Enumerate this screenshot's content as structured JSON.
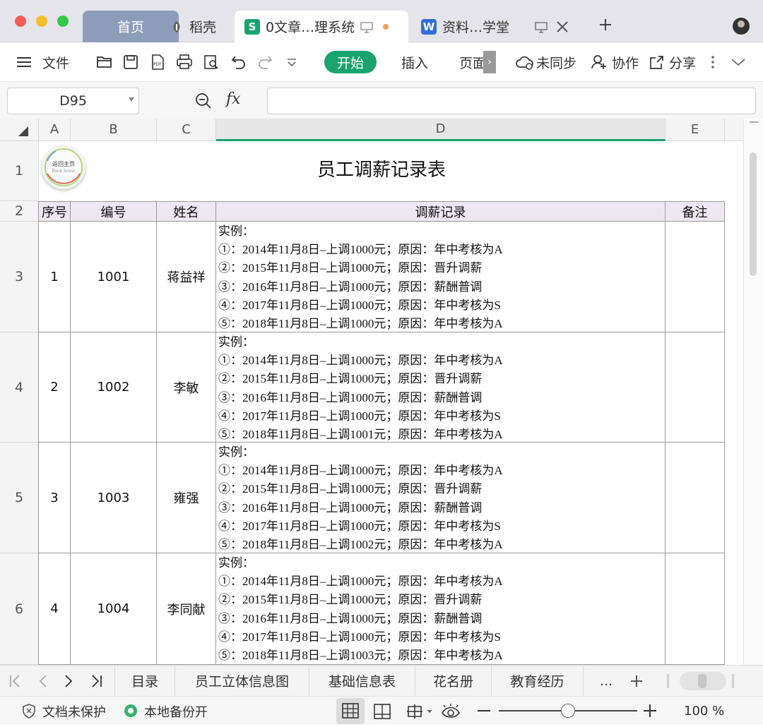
{
  "window": {
    "tabs": [
      {
        "label": "首页"
      },
      {
        "label": "稻壳"
      },
      {
        "label": "0文章…理系统"
      },
      {
        "label": "资料…学堂"
      }
    ]
  },
  "toolbar": {
    "file_label": "文件",
    "ribbon_tabs": [
      "开始",
      "插入",
      "页面"
    ],
    "sync_label": "未同步",
    "collab_label": "协作",
    "share_label": "分享"
  },
  "formula_bar": {
    "cell_ref": "D95",
    "fx_label": "fx",
    "formula_value": ""
  },
  "grid": {
    "columns": [
      "A",
      "B",
      "C",
      "D",
      "E"
    ],
    "rows": [
      "1",
      "2",
      "3",
      "4",
      "5",
      "6"
    ],
    "title": "员工调薪记录表",
    "logo_text": "返回主页",
    "logo_subtext": "Back home",
    "headers": [
      "序号",
      "编号",
      "姓名",
      "调薪记录",
      "备注"
    ],
    "records": [
      {
        "seq": "1",
        "id": "1001",
        "name": "蒋益祥",
        "lines": [
          "实例：",
          "①：2014年11月8日–上调1000元；原因：年中考核为A",
          "②：2015年11月8日–上调1000元；原因：晋升调薪",
          "③：2016年11月8日–上调1000元；原因：薪酬普调",
          "④：2017年11月8日–上调1000元；原因：年中考核为S",
          "⑤：2018年11月8日–上调1000元；原因：年中考核为A"
        ]
      },
      {
        "seq": "2",
        "id": "1002",
        "name": "李敏",
        "lines": [
          "实例：",
          "①：2014年11月8日–上调1000元；原因：年中考核为A",
          "②：2015年11月8日–上调1000元；原因：晋升调薪",
          "③：2016年11月8日–上调1000元；原因：薪酬普调",
          "④：2017年11月8日–上调1000元；原因：年中考核为S",
          "⑤：2018年11月8日–上调1001元；原因：年中考核为A"
        ]
      },
      {
        "seq": "3",
        "id": "1003",
        "name": "雍强",
        "lines": [
          "实例：",
          "①：2014年11月8日–上调1000元；原因：年中考核为A",
          "②：2015年11月8日–上调1000元；原因：晋升调薪",
          "③：2016年11月8日–上调1000元；原因：薪酬普调",
          "④：2017年11月8日–上调1000元；原因：年中考核为S",
          "⑤：2018年11月8日–上调1002元；原因：年中考核为A"
        ]
      },
      {
        "seq": "4",
        "id": "1004",
        "name": "李同献",
        "lines": [
          "实例：",
          "①：2014年11月8日–上调1000元；原因：年中考核为A",
          "②：2015年11月8日–上调1000元；原因：晋升调薪",
          "③：2016年11月8日–上调1000元；原因：薪酬普调",
          "④：2017年11月8日–上调1000元；原因：年中考核为S",
          "⑤：2018年11月8日–上调1003元；原因：年中考核为A"
        ]
      }
    ]
  },
  "sheets": {
    "tabs": [
      "目录",
      "员工立体信息图",
      "基础信息表",
      "花名册",
      "教育经历"
    ],
    "more_label": "..."
  },
  "status": {
    "protect_label": "文档未保护",
    "backup_label": "本地备份开",
    "zoom_label": "100 %",
    "zoom_fraction": 0.5
  },
  "colors": {
    "accent_green": "#1aa36f",
    "home_tab": "#8d9cb8",
    "header_fill": "#ece7f0"
  }
}
